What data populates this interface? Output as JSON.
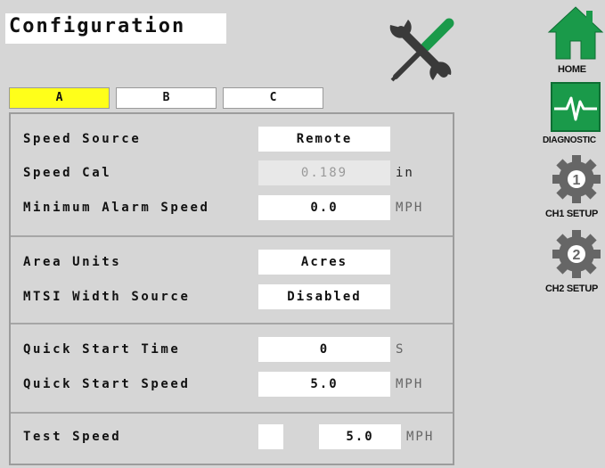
{
  "header": {
    "title": "Configuration"
  },
  "tabs": [
    {
      "label": "A",
      "active": true
    },
    {
      "label": "B",
      "active": false
    },
    {
      "label": "C",
      "active": false
    }
  ],
  "sections": {
    "speed": {
      "speed_source": {
        "label": "Speed Source",
        "value": "Remote"
      },
      "speed_cal": {
        "label": "Speed Cal",
        "value": "0.189",
        "unit": "in"
      },
      "min_alarm_speed": {
        "label": "Minimum Alarm Speed",
        "value": "0.0",
        "unit": "MPH"
      }
    },
    "area": {
      "area_units": {
        "label": "Area Units",
        "value": "Acres"
      },
      "mtsi_width_source": {
        "label": "MTSI Width Source",
        "value": "Disabled"
      }
    },
    "quick_start": {
      "time": {
        "label": "Quick Start Time",
        "value": "0",
        "unit": "S"
      },
      "speed": {
        "label": "Quick Start Speed",
        "value": "5.0",
        "unit": "MPH"
      }
    },
    "test": {
      "test_speed": {
        "label": "Test Speed",
        "value": "5.0",
        "unit": "MPH",
        "checked": false
      }
    }
  },
  "sidebar": {
    "home_label": "HOME",
    "diagnostic_label": "DIAGNOSTIC",
    "ch1_label": "CH1 SETUP",
    "ch2_label": "CH2 SETUP",
    "ch1_icon_number": "1",
    "ch2_icon_number": "2"
  },
  "icons": {
    "tools": "wrench-screwdriver-icon",
    "home": "home-icon",
    "diagnostic": "heartbeat-icon",
    "ch1": "gear-1-icon",
    "ch2": "gear-2-icon"
  },
  "colors": {
    "accent_green": "#1a9a4a",
    "tab_active": "#ffff1a",
    "gear_gray": "#666666"
  }
}
